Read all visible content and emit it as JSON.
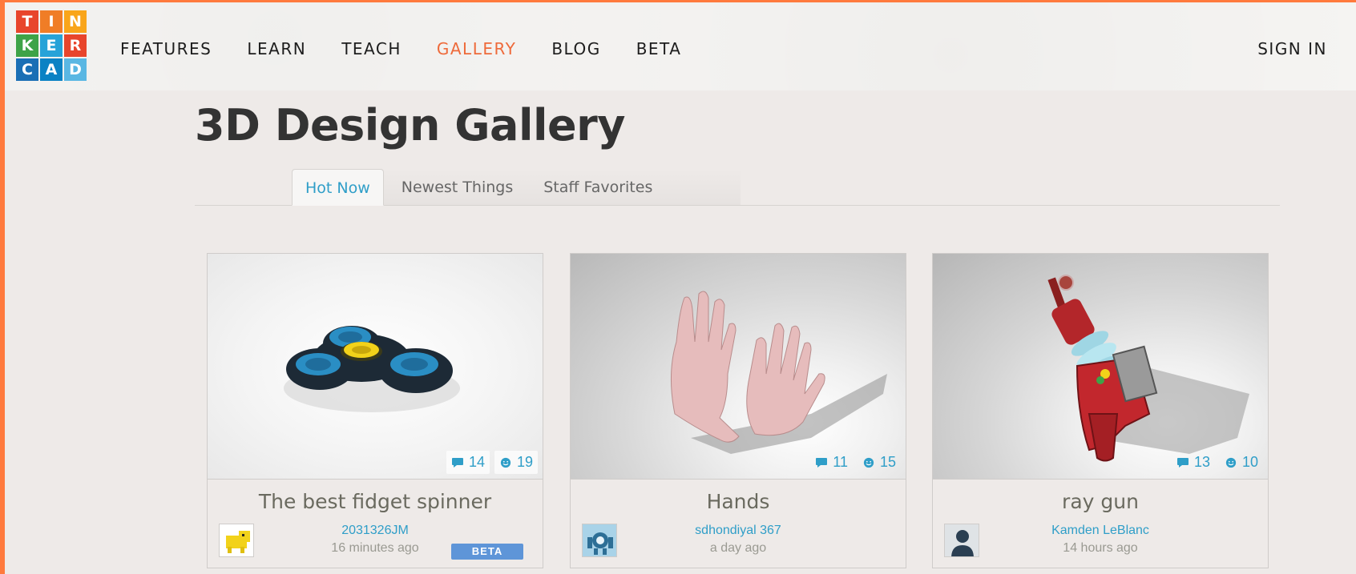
{
  "header": {
    "logo_letters": [
      "T",
      "I",
      "N",
      "K",
      "E",
      "R",
      "C",
      "A",
      "D"
    ],
    "logo_colors": [
      "#e8452c",
      "#f07d26",
      "#f9a51b",
      "#3ea348",
      "#27a3d8",
      "#e8452c",
      "#1a6fb5",
      "#0a82c4",
      "#5ab7e3"
    ],
    "nav": [
      {
        "label": "FEATURES"
      },
      {
        "label": "LEARN"
      },
      {
        "label": "TEACH"
      },
      {
        "label": "GALLERY",
        "active": true
      },
      {
        "label": "BLOG"
      },
      {
        "label": "BETA"
      }
    ],
    "signin_label": "SIGN IN"
  },
  "page": {
    "title": "3D Design Gallery",
    "tabs": [
      {
        "label": "Hot Now",
        "active": true
      },
      {
        "label": "Newest Things"
      },
      {
        "label": "Staff Favorites"
      }
    ]
  },
  "cards": [
    {
      "title": "The best fidget spinner",
      "author": "2031326JM",
      "time": "16 minutes ago",
      "comments": "14",
      "likes": "19",
      "badge": "BETA",
      "thumbnail": "fidget-spinner",
      "avatar": "yellow-pet"
    },
    {
      "title": "Hands",
      "author": "sdhondiyal 367",
      "time": "a day ago",
      "comments": "11",
      "likes": "15",
      "thumbnail": "hands",
      "avatar": "robot"
    },
    {
      "title": "ray gun",
      "author": "Kamden LeBlanc",
      "time": "14 hours ago",
      "comments": "13",
      "likes": "10",
      "thumbnail": "ray-gun",
      "avatar": "default-user"
    }
  ],
  "colors": {
    "accent_blue": "#2f9ec8",
    "active_nav": "#ee6a3a",
    "frame_orange": "#ff7a3d"
  }
}
